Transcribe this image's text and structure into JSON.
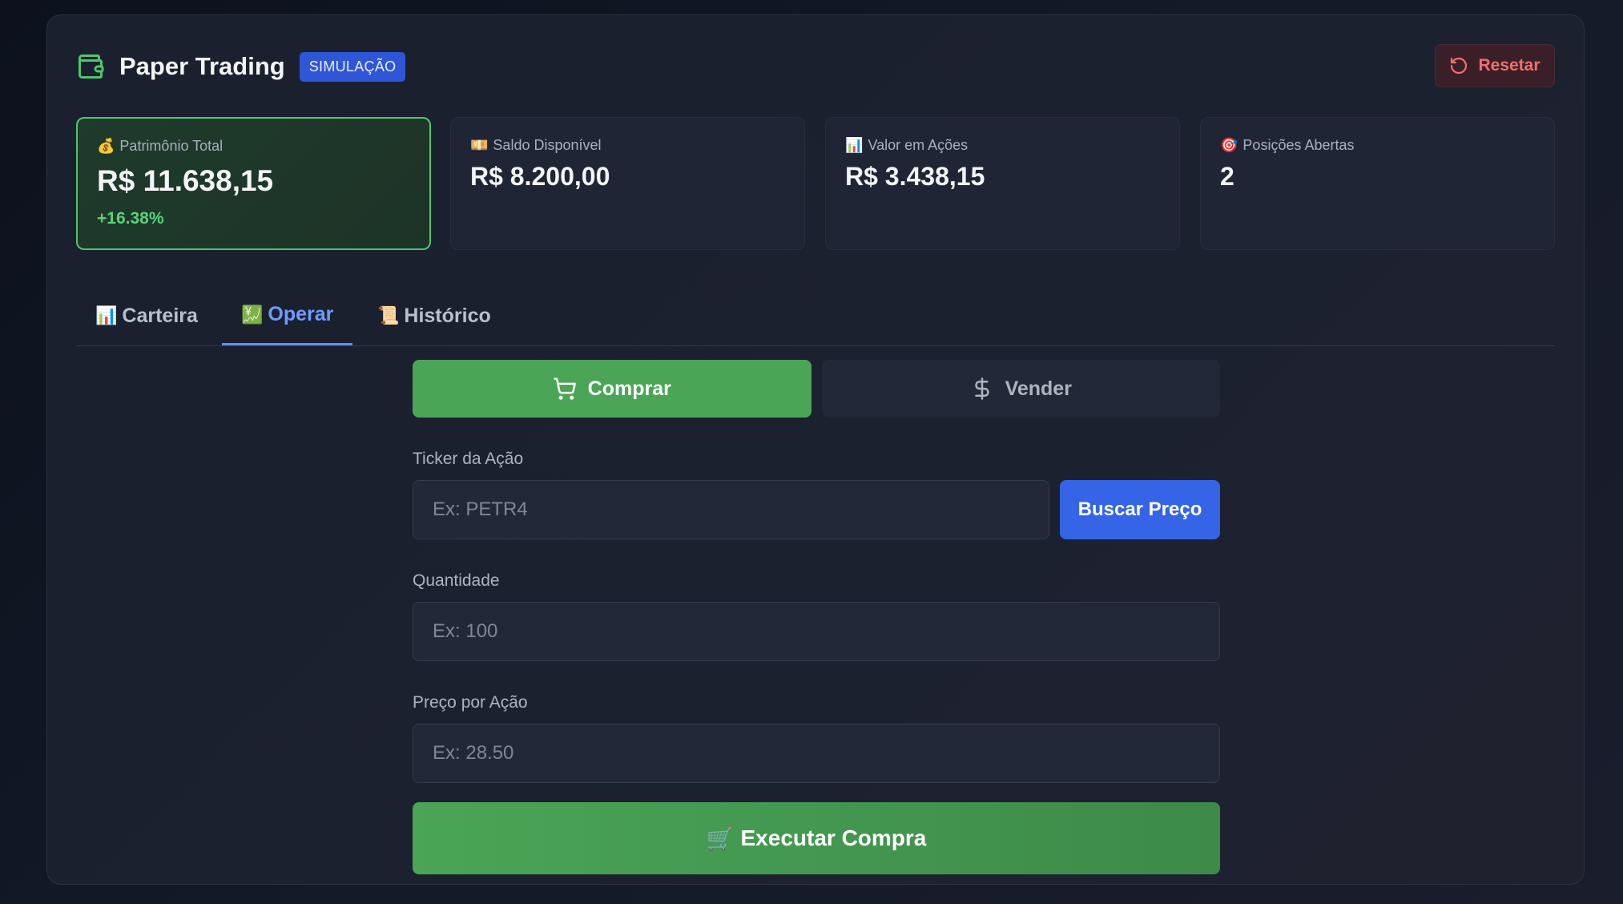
{
  "header": {
    "title": "Paper Trading",
    "badge": "SIMULAÇÃO",
    "reset_label": "Resetar"
  },
  "stats": [
    {
      "icon": "💰",
      "label": "Patrimônio Total",
      "value": "R$ 11.638,15",
      "change": "+16.38%"
    },
    {
      "icon": "💴",
      "label": "Saldo Disponível",
      "value": "R$ 8.200,00"
    },
    {
      "icon": "📊",
      "label": "Valor em Ações",
      "value": "R$ 3.438,15"
    },
    {
      "icon": "🎯",
      "label": "Posições Abertas",
      "value": "2"
    }
  ],
  "tabs": [
    {
      "icon": "📊",
      "label": "Carteira"
    },
    {
      "icon": "💹",
      "label": "Operar"
    },
    {
      "icon": "📜",
      "label": "Histórico"
    }
  ],
  "form": {
    "buy_label": "Comprar",
    "sell_label": "Vender",
    "ticker_label": "Ticker da Ação",
    "ticker_placeholder": "Ex: PETR4",
    "search_label": "Buscar Preço",
    "quantity_label": "Quantidade",
    "quantity_placeholder": "Ex: 100",
    "price_label": "Preço por Ação",
    "price_placeholder": "Ex: 28.50",
    "execute_icon": "🛒",
    "execute_label": "Executar Compra"
  },
  "colors": {
    "accent_green": "#4aa556",
    "accent_blue": "#3564e6",
    "reset_red": "#ef6f6f",
    "positive": "#5bd27a"
  }
}
